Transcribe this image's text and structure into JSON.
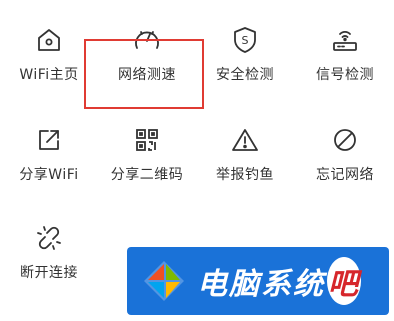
{
  "menu": {
    "items": [
      {
        "label": "WiFi主页",
        "icon": "home-icon"
      },
      {
        "label": "网络测速",
        "icon": "speed-test-icon"
      },
      {
        "label": "安全检测",
        "icon": "shield-icon"
      },
      {
        "label": "信号检测",
        "icon": "router-signal-icon"
      },
      {
        "label": "分享WiFi",
        "icon": "share-icon"
      },
      {
        "label": "分享二维码",
        "icon": "qr-code-icon"
      },
      {
        "label": "举报钓鱼",
        "icon": "warning-icon"
      },
      {
        "label": "忘记网络",
        "icon": "forbidden-icon"
      },
      {
        "label": "断开连接",
        "icon": "disconnect-link-icon"
      }
    ]
  },
  "highlight": {
    "target": "网络测速",
    "color": "#e03b33"
  },
  "watermark": {
    "text_main": "电脑系统",
    "text_last": "吧",
    "background": "#1a72d8"
  }
}
